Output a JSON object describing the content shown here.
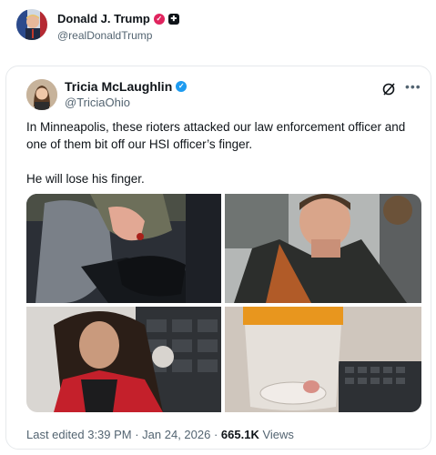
{
  "outer": {
    "name": "Donald J. Trump",
    "handle": "@realDonaldTrump",
    "avatar_icon": "avatar-portrait"
  },
  "inner": {
    "name": "Tricia McLaughlin",
    "handle": "@TriciaOhio",
    "verified_color": "#1d9bf0",
    "avatar_icon": "avatar-portrait",
    "grok_icon": "grok-icon",
    "more_icon": "more-icon",
    "text_paragraph_1": "In Minneapolis, these rioters attacked our law enforcement officer and one of them bit off our HSI officer’s finger.",
    "text_paragraph_2": "He will lose his finger.",
    "media": [
      {
        "subject": "injured-hand-photo"
      },
      {
        "subject": "detained-man-photo"
      },
      {
        "subject": "detained-woman-photo"
      },
      {
        "subject": "finger-in-container-photo"
      }
    ],
    "meta": {
      "prefix": "Last edited 3:39 PM · Jan 24, 2026 · ",
      "views_count": "665.1K",
      "views_label": " Views"
    }
  }
}
